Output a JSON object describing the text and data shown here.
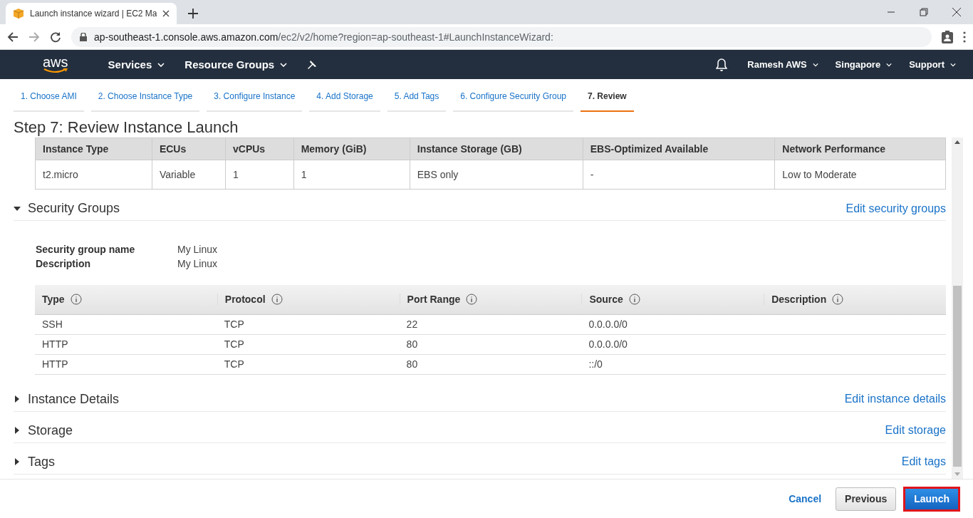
{
  "browser": {
    "tab_title": "Launch instance wizard | EC2 Ma",
    "url_host": "ap-southeast-1.console.aws.amazon.com",
    "url_path": "/ec2/v2/home?region=ap-southeast-1#LaunchInstanceWizard:"
  },
  "nav": {
    "logo": "aws",
    "left": [
      "Services",
      "Resource Groups"
    ],
    "right": [
      "Ramesh AWS",
      "Singapore",
      "Support"
    ]
  },
  "steps": [
    {
      "label": "1. Choose AMI",
      "selected": false
    },
    {
      "label": "2. Choose Instance Type",
      "selected": false
    },
    {
      "label": "3. Configure Instance",
      "selected": false
    },
    {
      "label": "4. Add Storage",
      "selected": false
    },
    {
      "label": "5. Add Tags",
      "selected": false
    },
    {
      "label": "6. Configure Security Group",
      "selected": false
    },
    {
      "label": "7. Review",
      "selected": true
    }
  ],
  "page_title": "Step 7: Review Instance Launch",
  "instance_table": {
    "columns": [
      "Instance Type",
      "ECUs",
      "vCPUs",
      "Memory (GiB)",
      "Instance Storage (GB)",
      "EBS-Optimized Available",
      "Network Performance"
    ],
    "rows": [
      [
        "t2.micro",
        "Variable",
        "1",
        "1",
        "EBS only",
        "-",
        "Low to Moderate"
      ]
    ]
  },
  "sections": [
    {
      "title": "Security Groups",
      "expanded": true,
      "edit_link": "Edit security groups",
      "details": [
        {
          "label": "Security group name",
          "value": "My Linux"
        },
        {
          "label": "Description",
          "value": "My Linux"
        }
      ],
      "rules_table": {
        "columns": [
          "Type",
          "Protocol",
          "Port Range",
          "Source",
          "Description"
        ],
        "rows": [
          [
            "SSH",
            "TCP",
            "22",
            "0.0.0.0/0",
            ""
          ],
          [
            "HTTP",
            "TCP",
            "80",
            "0.0.0.0/0",
            ""
          ],
          [
            "HTTP",
            "TCP",
            "80",
            "::/0",
            ""
          ]
        ]
      }
    },
    {
      "title": "Instance Details",
      "expanded": false,
      "edit_link": "Edit instance details"
    },
    {
      "title": "Storage",
      "expanded": false,
      "edit_link": "Edit storage"
    },
    {
      "title": "Tags",
      "expanded": false,
      "edit_link": "Edit tags"
    }
  ],
  "footer": {
    "cancel": "Cancel",
    "previous": "Previous",
    "launch": {
      "label": "Launch",
      "highlighted": true
    }
  }
}
